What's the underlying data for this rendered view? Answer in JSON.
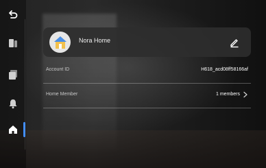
{
  "home": {
    "name": "Nora Home"
  },
  "account": {
    "label": "Account ID",
    "value": "H618_acd08ff58166af"
  },
  "member": {
    "label": "Home Member",
    "value": "1 members"
  },
  "colors": {
    "accent": "#3d8bff",
    "avatar_bg": "#e6e6e6"
  },
  "icons": {
    "back": "back-arrow-icon",
    "device": "device-panel-icon",
    "scene": "scene-icon",
    "alarm": "bell-icon",
    "home": "home-icon",
    "edit": "pencil-icon",
    "chevron": "chevron-right-icon"
  }
}
